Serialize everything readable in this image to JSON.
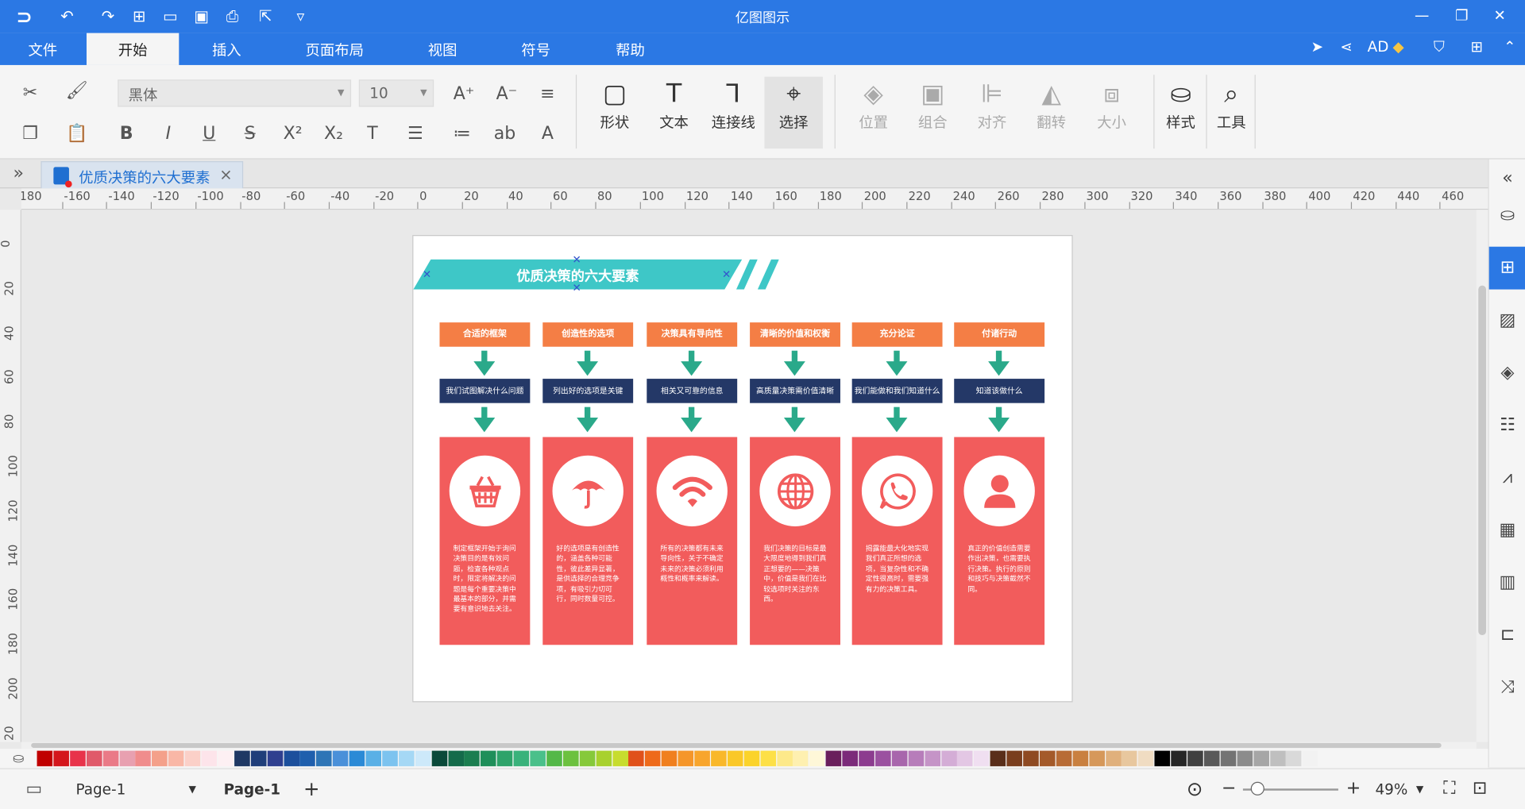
{
  "app": {
    "title": "亿图图示",
    "user": "AD"
  },
  "menu": {
    "items": [
      "文件",
      "开始",
      "插入",
      "页面布局",
      "视图",
      "符号",
      "帮助"
    ],
    "active": "开始"
  },
  "ribbon": {
    "font_name": "黑体",
    "font_size": "10",
    "big_buttons": [
      {
        "label": "形状",
        "icon": "rectangle-icon"
      },
      {
        "label": "文本",
        "icon": "text-icon"
      },
      {
        "label": "连接线",
        "icon": "connector-icon"
      },
      {
        "label": "选择",
        "icon": "cursor-icon"
      },
      {
        "label": "位置",
        "icon": "layers-icon"
      },
      {
        "label": "组合",
        "icon": "group-icon"
      },
      {
        "label": "对齐",
        "icon": "align-icon"
      },
      {
        "label": "翻转",
        "icon": "flip-icon"
      },
      {
        "label": "大小",
        "icon": "size-icon"
      },
      {
        "label": "样式",
        "icon": "paint-bucket-icon"
      },
      {
        "label": "工具",
        "icon": "tools-icon"
      }
    ]
  },
  "document": {
    "tab_name": "优质决策的六大要素"
  },
  "ruler": {
    "h_labels": [
      "180",
      "-160",
      "-140",
      "-120",
      "-100",
      "-80",
      "-60",
      "-40",
      "-20",
      "0",
      "20",
      "40",
      "60",
      "80",
      "100",
      "120",
      "140",
      "160",
      "180",
      "200",
      "220",
      "240",
      "260",
      "280",
      "300",
      "320",
      "340",
      "360",
      "380",
      "400",
      "420",
      "440",
      "460"
    ],
    "v_labels": [
      "0",
      "20",
      "40",
      "60",
      "80",
      "100",
      "120",
      "140",
      "160",
      "180",
      "200",
      "20"
    ]
  },
  "diagram": {
    "title": "优质决策的六大要素",
    "columns": [
      {
        "head": "合适的框架",
        "sub": "我们试图解决什么问题",
        "icon": "shopping-basket-icon",
        "text": "制定框架开始于询问决策目的是有效问题，检查各种观点时，限定将解决的问题是每个重要决策中最基本的部分，并需要有意识地去关注。"
      },
      {
        "head": "创造性的选项",
        "sub": "列出好的选项是关键",
        "icon": "umbrella-icon",
        "text": "好的选项是有创造性的，涵盖各种可能性，彼此差异显著，是供选择的合理竞争项，有吸引力切可行，同时数量可控。"
      },
      {
        "head": "决策具有导向性",
        "sub": "相关又可靠的信息",
        "icon": "wifi-icon",
        "text": "所有的决策都有未来导向性，关于不确定未来的决策必须利用概性和概率来解读。"
      },
      {
        "head": "清晰的价值和权衡",
        "sub": "高质量决策需价值清晰",
        "icon": "globe-icon",
        "text": "我们决策的目标是最大限度地得到我们真正想要的——决策中，价值是我们在比较选项时关注的东西。"
      },
      {
        "head": "充分论证",
        "sub": "我们能做和我们知道什么",
        "icon": "whatsapp-icon",
        "text": "揭露能最大化地实现我们真正所想的选项，当复杂性和不确定性很高时，需要强有力的决策工具。"
      },
      {
        "head": "付诸行动",
        "sub": "知道该做什么",
        "icon": "user-icon",
        "text": "真正的价值创造需要作出决策，也需要执行决策。执行的原则和技巧与决策截然不同。"
      }
    ]
  },
  "palette": [
    "#c00000",
    "#d4161c",
    "#e8334a",
    "#e05a6a",
    "#ea7a87",
    "#e8a0b0",
    "#f08c8c",
    "#f4a08a",
    "#f9b7a6",
    "#fbd0c8",
    "#fde4ea",
    "#fdf0f3",
    "#1f3864",
    "#203e7a",
    "#2f3f8f",
    "#1c4f9c",
    "#1f5fad",
    "#2e75b6",
    "#4a90d9",
    "#2b8ad6",
    "#5ab0e6",
    "#7cc3ef",
    "#a5d8f5",
    "#cde9fa",
    "#0a4a3a",
    "#146b4a",
    "#1b7e50",
    "#1f8f5a",
    "#2ea36a",
    "#39b27b",
    "#4ac08a",
    "#54b848",
    "#6cc13f",
    "#86c93a",
    "#a8d12e",
    "#c7dc2e",
    "#e0511a",
    "#ee6a1a",
    "#f07f1e",
    "#f5962a",
    "#f8a52c",
    "#f9b82a",
    "#fac828",
    "#fbd32a",
    "#fde047",
    "#fde98a",
    "#fef0b0",
    "#fef7d8",
    "#6a1f5c",
    "#7b2a7a",
    "#8c3c8f",
    "#9b51a0",
    "#a866ac",
    "#b77dba",
    "#c594c7",
    "#d4add6",
    "#e3c7e4",
    "#f0dff1",
    "#5a2e1a",
    "#7a3e1e",
    "#8f4a22",
    "#a45a2a",
    "#b86c36",
    "#c98040",
    "#d6985a",
    "#e0b07c",
    "#e8c79e",
    "#f0dcc2",
    "#000000",
    "#262626",
    "#404040",
    "#595959",
    "#737373",
    "#8c8c8c",
    "#a6a6a6",
    "#bfbfbf",
    "#d9d9d9",
    "#f2f2f2"
  ],
  "status": {
    "page_selector": "Page-1",
    "page_tab": "Page-1",
    "zoom": "49%"
  }
}
